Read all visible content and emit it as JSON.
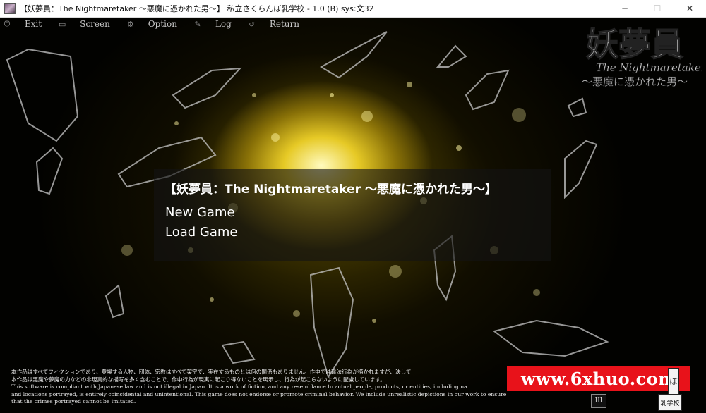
{
  "window": {
    "title": "【妖夢員：The Nightmaretaker ～悪魔に憑かれた男～】 私立さくらんぼ乳学校 - 1.0 (B) sys:文32",
    "minimize_glyph": "─",
    "maximize_glyph": "☐",
    "close_glyph": "✕"
  },
  "menubar": {
    "items": [
      {
        "label": "Exit",
        "icon": "power-icon"
      },
      {
        "label": "Screen",
        "icon": "monitor-icon"
      },
      {
        "label": "Option",
        "icon": "gear-icon"
      },
      {
        "label": "Log",
        "icon": "scroll-icon"
      },
      {
        "label": "Return",
        "icon": "return-icon"
      }
    ]
  },
  "logo": {
    "kanji": "妖夢員",
    "english": "The Nightmaretaker",
    "subtitle": "～悪魔に憑かれた男～"
  },
  "dialog": {
    "title": "【妖夢員：The Nightmaretaker ～悪魔に憑かれた男～】",
    "options": [
      "New Game",
      "Load Game"
    ]
  },
  "disclaimer": {
    "lines": [
      "本作品はすべてフィクションであり、登場する人物、団体、宗教はすべて架空で、実在するものとは何の関係もありません。作中では違法行為が描かれますが、決して",
      "本作品は悪魔や夢魔の力などの非現実的な描写を多く含むことで、作中行為が現実に起こり得ないことを明示し、行為が起こらないように配慮しています。",
      "This software is compliant with Japanese law and is not illegal in Japan. It is a work of fiction, and any resemblance to actual people, products, or entities, including na",
      " and locations portrayed, is entirely coincidental and unintentional. This game does not endorse or promote criminal behavior. We include unrealistic depictions in our work to ensure",
      " that the crimes portrayed cannot be imitated."
    ]
  },
  "watermark": {
    "text": "www.6xhuo.com",
    "color": "#e8121a"
  },
  "stamps": {
    "top": "ぼ",
    "bottom": "乳学校",
    "left": "III"
  },
  "colors": {
    "background_glow": "#f0d228",
    "text": "#ffffff",
    "menu_text": "#c8c8c8"
  }
}
